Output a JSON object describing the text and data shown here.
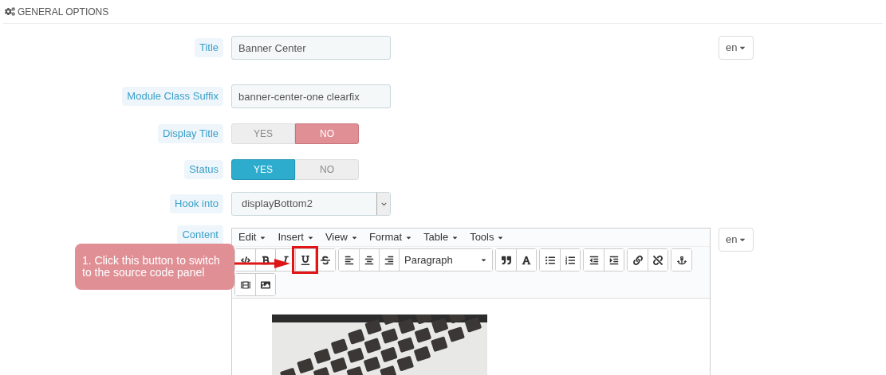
{
  "section": {
    "title": "GENERAL OPTIONS"
  },
  "fields": [
    {
      "kind": "text",
      "label": "Title",
      "value": "Banner Center",
      "lang": "en"
    },
    {
      "kind": "text",
      "label": "Module Class Suffix",
      "value": "banner-center-one clearfix"
    },
    {
      "kind": "toggle",
      "label": "Display Title",
      "options": [
        {
          "label": "YES",
          "selected": false
        },
        {
          "label": "NO",
          "selected": true
        }
      ]
    },
    {
      "kind": "toggle",
      "label": "Status",
      "options": [
        {
          "label": "YES",
          "selected": true
        },
        {
          "label": "NO",
          "selected": false
        }
      ]
    },
    {
      "kind": "select",
      "label": "Hook into",
      "value": "displayBottom2"
    },
    {
      "kind": "editor",
      "label": "Content",
      "lang": "en",
      "menus": [
        "Edit",
        "Insert",
        "View",
        "Format",
        "Table",
        "Tools"
      ],
      "block_format": "Paragraph"
    }
  ],
  "callout": {
    "text": "1. Click this button to switch to the source code panel"
  }
}
